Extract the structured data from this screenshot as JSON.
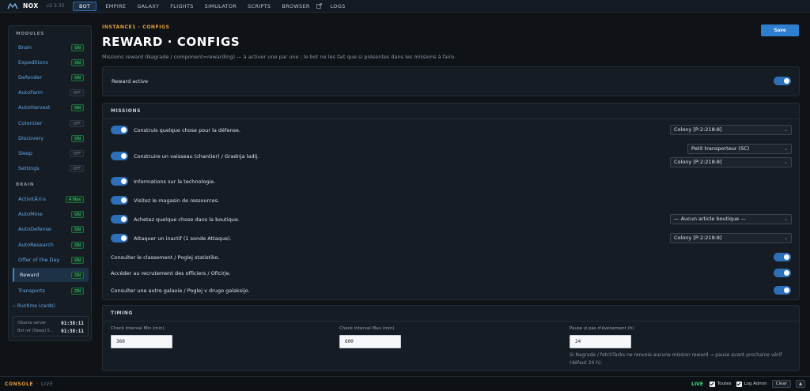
{
  "app": {
    "name": "NOX",
    "version": "v2.3.35"
  },
  "nav": {
    "items": [
      "BOT",
      "EMPIRE",
      "GALAXY",
      "FLIGHTS",
      "SIMULATOR",
      "SCRIPTS",
      "BROWSER",
      "LOGS"
    ],
    "active": "BOT"
  },
  "sidebar": {
    "modules_heading": "MODULES",
    "modules": [
      {
        "label": "Brain",
        "status": "ON"
      },
      {
        "label": "Expeditions",
        "status": "ON"
      },
      {
        "label": "Defender",
        "status": "ON"
      },
      {
        "label": "AutoFarm",
        "status": "OFF"
      },
      {
        "label": "AutoHarvest",
        "status": "ON"
      },
      {
        "label": "Colonizer",
        "status": "OFF"
      },
      {
        "label": "Discovery",
        "status": "ON"
      },
      {
        "label": "Sleep",
        "status": "OFF"
      },
      {
        "label": "Settings",
        "status": "OFF"
      }
    ],
    "brain_heading": "BRAIN",
    "brain": [
      {
        "label": "ActivitÃ©s",
        "status": "4 files"
      },
      {
        "label": "AutoMine",
        "status": "ON"
      },
      {
        "label": "AutoDefense",
        "status": "ON"
      },
      {
        "label": "AutoResearch",
        "status": "ON"
      },
      {
        "label": "Offer of the Day",
        "status": "ON"
      },
      {
        "label": "Reward",
        "status": "ON",
        "active": true
      },
      {
        "label": "Transports",
        "status": "ON"
      }
    ],
    "runtime_label": "− Runtime (cards)",
    "clocks": [
      {
        "label": "OGame server",
        "value": "01:38:11"
      },
      {
        "label": "Bot ref (Sleep) 5...",
        "value": "01:38:11"
      }
    ]
  },
  "page": {
    "breadcrumb": "INSTANCE1 · CONFIGS",
    "title": "REWARD · CONFIGS",
    "subtitle": "Missions reward (Nagrade / component=rewarding) — à activer une par une ; le bot ne les fait que si présentes dans les missions à faire.",
    "save_label": "Save"
  },
  "reward_active": {
    "label": "Reward active",
    "on": true
  },
  "missions": {
    "heading": "MISSIONS",
    "rows": [
      {
        "label": "Construis quelque chose pour la défense.",
        "on": true,
        "selects": [
          "Colony [P:2:218:8]"
        ]
      },
      {
        "label": "Construire un vaisseau (chantier) / Gradnja ladij.",
        "on": true,
        "selects": [
          "Petit transporteur (SC)",
          "Colony [P:2:218:8]"
        ]
      },
      {
        "label": "Informations sur la technologie.",
        "on": true,
        "selects": []
      },
      {
        "label": "Visitez le magasin de ressources.",
        "on": true,
        "selects": []
      },
      {
        "label": "Achetez quelque chose dans la boutique.",
        "on": true,
        "selects": [
          "— Aucun article boutique —"
        ]
      },
      {
        "label": "Attaquer un inactif (1 sonde Attaque).",
        "on": true,
        "selects": [
          "Colony [P:2:218:8]"
        ]
      },
      {
        "label": "Consulter le classement / Poglej statistiko.",
        "on": true,
        "selects": []
      },
      {
        "label": "Accéder au recrutement des officiers / Oficirje.",
        "on": true,
        "selects": []
      },
      {
        "label": "Consulter une autre galaxie / Poglej v drugo galaksijo.",
        "on": true,
        "selects": []
      }
    ]
  },
  "timing": {
    "heading": "TIMING",
    "min_label": "Check Interval Min (min)",
    "min_value": "360",
    "max_label": "Check Interval Max (min)",
    "max_value": "600",
    "pause_label": "Pause si pas d'événement (h)",
    "pause_value": "24",
    "hint": "Si Nagrade / fetchTasks ne renvoie aucune mission reward → pause avant prochaine vérif (défaut 24 h)."
  },
  "console": {
    "title": "CONSOLE",
    "sep": "·",
    "mode": "LIVE",
    "live_label": "LIVE",
    "filter_all": "Toutes",
    "filter_admin": "Log Admin",
    "clear_label": "Clear",
    "up_label": "▲"
  },
  "colors": {
    "accent": "#2f7fd1",
    "on": "#4ade80",
    "breadcrumb": "#e6a03a"
  }
}
